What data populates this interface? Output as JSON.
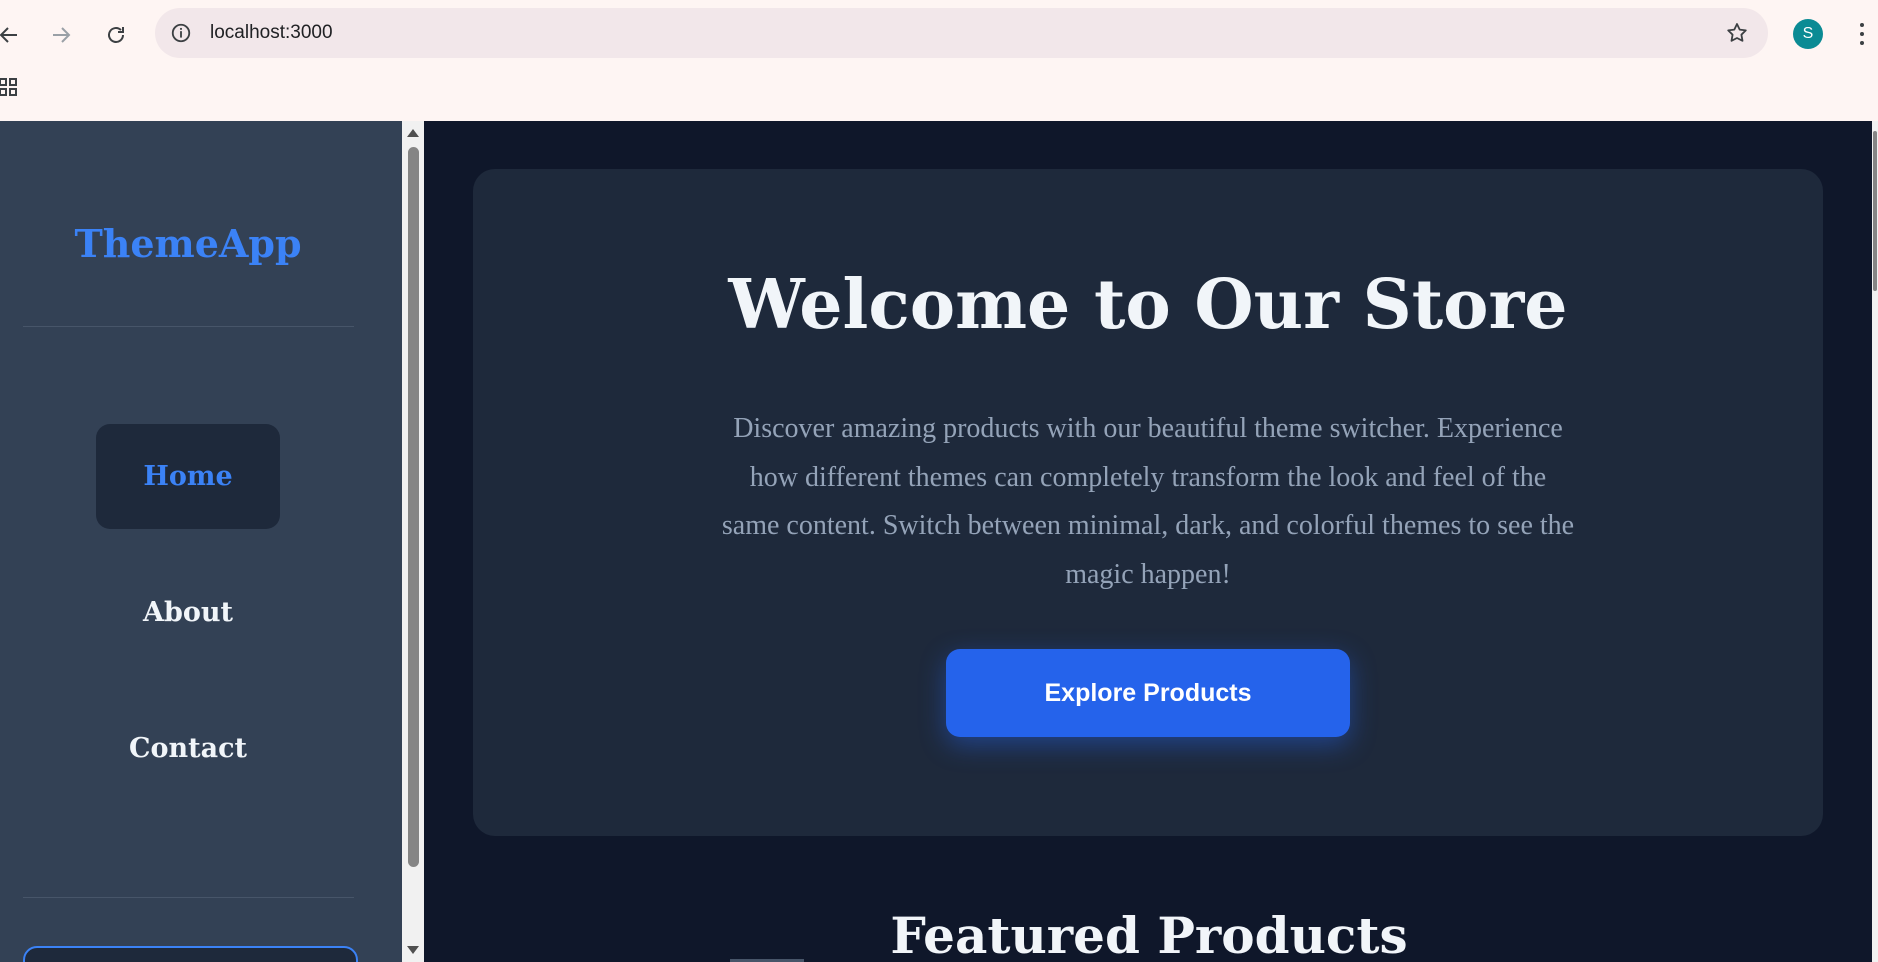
{
  "browser": {
    "url": "localhost:3000",
    "profile_initial": "S"
  },
  "sidebar": {
    "brand": "ThemeApp",
    "items": [
      {
        "label": "Home",
        "active": true
      },
      {
        "label": "About",
        "active": false
      },
      {
        "label": "Contact",
        "active": false
      }
    ]
  },
  "hero": {
    "title": "Welcome to Our Store",
    "description": "Discover amazing products with our beautiful theme switcher. Experience how different themes can completely transform the look and feel of the same content. Switch between minimal, dark, and colorful themes to see the magic happen!",
    "cta_label": "Explore Products"
  },
  "featured": {
    "title": "Featured Products"
  },
  "colors": {
    "accent": "#3b82f6",
    "button": "#2563eb",
    "sidebar_bg": "#334155",
    "main_bg": "#0f172a",
    "card_bg": "#1e293b"
  },
  "icons": [
    "back-arrow-icon",
    "forward-arrow-icon",
    "reload-icon",
    "site-info-icon",
    "bookmark-star-icon",
    "kebab-menu-icon",
    "apps-grid-icon"
  ]
}
